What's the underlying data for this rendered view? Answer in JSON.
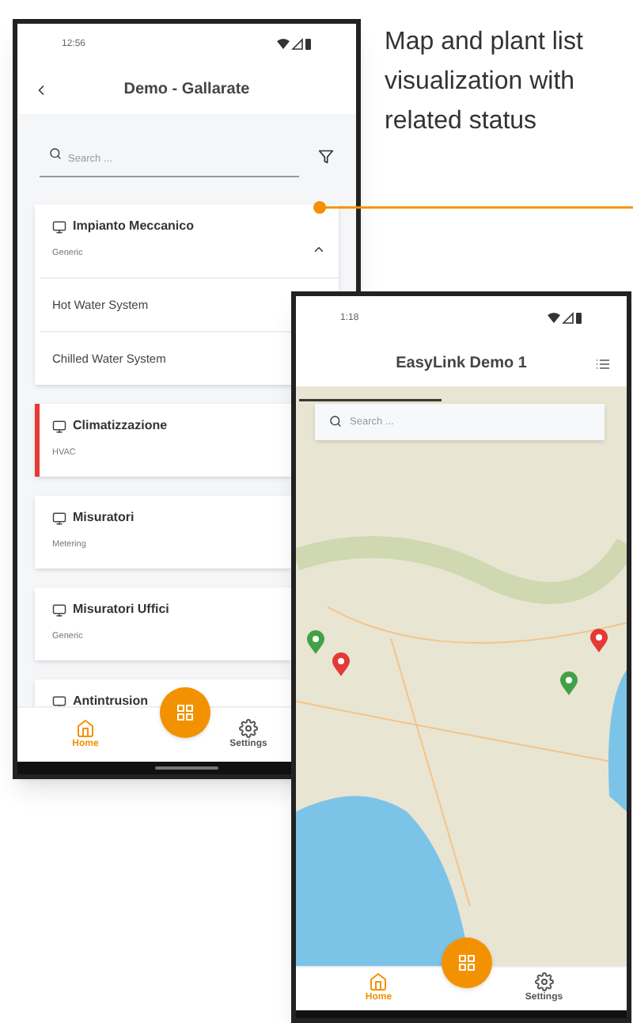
{
  "caption": "Map and plant list visualization with related status",
  "list_phone": {
    "time": "12:56",
    "title": "Demo - Gallarate",
    "search": {
      "placeholder": "Search ..."
    },
    "plants": [
      {
        "name": "Impianto Meccanico",
        "type": "Generic",
        "expanded": true,
        "alarm": false,
        "systems": [
          "Hot Water System",
          "Chilled Water System"
        ]
      },
      {
        "name": "Climatizzazione",
        "type": "HVAC",
        "alarm": true
      },
      {
        "name": "Misuratori",
        "type": "Metering",
        "alarm": false
      },
      {
        "name": "Misuratori Uffici",
        "type": "Generic",
        "alarm": false
      },
      {
        "name": "Antintrusion",
        "alarm": false
      }
    ],
    "nav": [
      {
        "kind": "home",
        "label": "Home",
        "selected": true
      },
      {
        "kind": "settings",
        "label": "Settings",
        "selected": false
      }
    ]
  },
  "map_phone": {
    "time": "1:18",
    "title": "EasyLink Demo 1",
    "search": {
      "placeholder": "Search ..."
    },
    "pins": [
      {
        "color": "#43a047"
      },
      {
        "color": "#e53935"
      },
      {
        "color": "#e53935"
      },
      {
        "color": "#43a047"
      }
    ],
    "nav": [
      {
        "kind": "home",
        "label": "Home",
        "selected": true
      },
      {
        "kind": "settings",
        "label": "Settings",
        "selected": false
      }
    ]
  }
}
